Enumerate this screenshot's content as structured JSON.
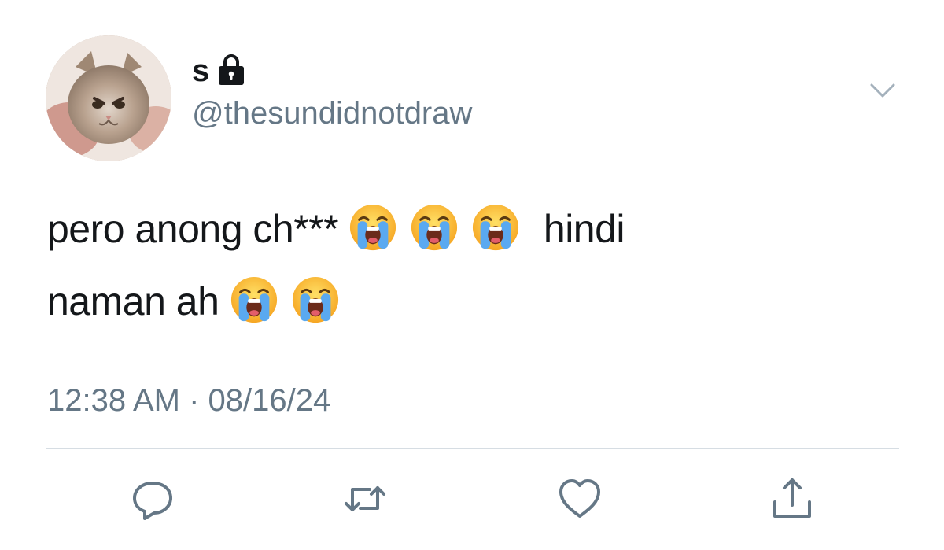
{
  "header": {
    "display_name": "s",
    "handle": "@thesundidnotdraw",
    "protected_icon": "lock-icon",
    "menu_icon": "chevron-down-icon"
  },
  "tweet": {
    "line1_text": "pero anong ch***",
    "line1_emoji_count": 3,
    "line1_after": "hindi",
    "line2_text": "naman ah",
    "line2_emoji_count": 2,
    "emoji_name": "loudly-crying-face"
  },
  "timestamp": "12:38 AM · 08/16/24",
  "actions": [
    "reply-icon",
    "retweet-icon",
    "like-icon",
    "share-icon"
  ],
  "colors": {
    "text": "#14171a",
    "secondary": "#657786",
    "divider": "#d6dde3"
  }
}
